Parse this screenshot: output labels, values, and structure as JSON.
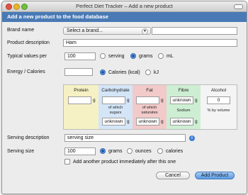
{
  "window": {
    "title": "Perfect Diet Tracker – Add a new product"
  },
  "header": {
    "title": "Add a new product to the food database"
  },
  "brand": {
    "label": "Brand name",
    "select_value": "Select a brand...",
    "text_value": ""
  },
  "description": {
    "label": "Product description",
    "value": "Ham"
  },
  "typical": {
    "label": "Typical values per",
    "value": "100",
    "options": [
      "serving",
      "grams",
      "mL"
    ],
    "selected": "grams"
  },
  "energy": {
    "label": "Energy / Calories",
    "value": "",
    "options": [
      "Calories (kcal)",
      "kJ"
    ],
    "selected": "Calories (kcal)"
  },
  "nutrients": {
    "protein": {
      "title": "Protein",
      "value": "",
      "unit": "g"
    },
    "carbohydrate": {
      "title": "Carbohydrate",
      "value": "",
      "unit": "g",
      "sub_label": "of which sugars",
      "sub_value": "unknown",
      "sub_unit": "g"
    },
    "fat": {
      "title": "Fat",
      "value": "",
      "unit": "g",
      "sub_label": "of which saturates",
      "sub_value": "unknown",
      "sub_unit": "g"
    },
    "fibre": {
      "title": "Fibre",
      "value": "unknown",
      "unit": "g",
      "sub_label": "Sodium",
      "sub_value": "unknown",
      "sub_unit": "g"
    },
    "alcohol": {
      "title": "Alcohol",
      "value": "0",
      "sub_label": "% by volume"
    }
  },
  "serving_description": {
    "label": "Serving description",
    "value": "serving size"
  },
  "serving_size": {
    "label": "Serving size",
    "value": "100",
    "options": [
      "grams",
      "ounces",
      "calories"
    ],
    "selected": "grams"
  },
  "add_another": {
    "label": "Add another product immediately after this one",
    "checked": false
  },
  "buttons": {
    "cancel": "Cancel",
    "add": "Add Product"
  },
  "colors": {
    "header": "#4a7ab5",
    "protein_bg": "#f6f1c4",
    "carb_bg": "#d4e5f7",
    "fat_bg": "#f2caca",
    "fibre_bg": "#cdeed2",
    "accent": "#3b7fd4"
  }
}
